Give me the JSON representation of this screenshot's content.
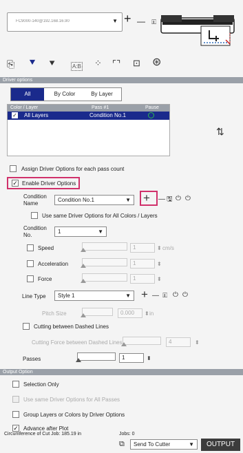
{
  "header": {
    "device_value": "FC9000-140@192.168.16.90",
    "add_glyph": "+",
    "remove_glyph": "—"
  },
  "toolbar": {
    "icons": [
      "page-setup-icon",
      "driver-options-icon",
      "add-pass-icon",
      "text-style-icon",
      "registration-marks-icon",
      "crop-frame-icon",
      "weed-icon",
      "support-icon"
    ]
  },
  "driver_options": {
    "section_title": "Driver options",
    "tabs": [
      "All",
      "By Color",
      "By Layer"
    ],
    "table_headers": [
      "Color / Layer",
      "Pass #1",
      "Pause"
    ],
    "row": {
      "name": "All Layers",
      "condition": "Condition No.1"
    },
    "assign_label": "Assign Driver Options for each pass count",
    "enable_label": "Enable Driver Options",
    "condition_name_label": "Condition\nName",
    "condition_name_value": "Condition No.1",
    "use_same_label": "Use same Driver Options for All Colors / Layers",
    "condition_no_label": "Condition\nNo.",
    "condition_no_value": "1",
    "speed_label": "Speed",
    "speed_value": "1",
    "speed_unit": "cm/s",
    "accel_label": "Acceleration",
    "accel_value": "1",
    "force_label": "Force",
    "force_value": "1",
    "line_type_label": "Line Type",
    "line_type_value": "Style 1",
    "pitch_label": "Pitch Size",
    "pitch_value": "0.000",
    "pitch_unit": "in",
    "cutting_dashed_label": "Cutting between Dashed Lines",
    "cutting_force_label": "Cutting Force between Dashed Lines",
    "cutting_force_value": "4",
    "passes_label": "Passes",
    "passes_value": "1"
  },
  "output_option": {
    "section_title": "Output Option",
    "selection_only": "Selection Only",
    "use_same_all_passes": "Use same Driver Options for All Passes",
    "group_layers": "Group Layers or Colors by Driver Options",
    "advance_after_plot": "Advance after Plot"
  },
  "footer": {
    "circumference": "Circumference of Cut Job: 185.19 in",
    "jobs": "Jobs: 0",
    "send_to": "Send To Cutter",
    "output_button": "OUTPUT"
  },
  "colors": {
    "selected_row": "#1a2a8c",
    "highlight_box": "#d0306a",
    "section_bar": "#9aa0a8",
    "status_green": "#2db84d"
  }
}
